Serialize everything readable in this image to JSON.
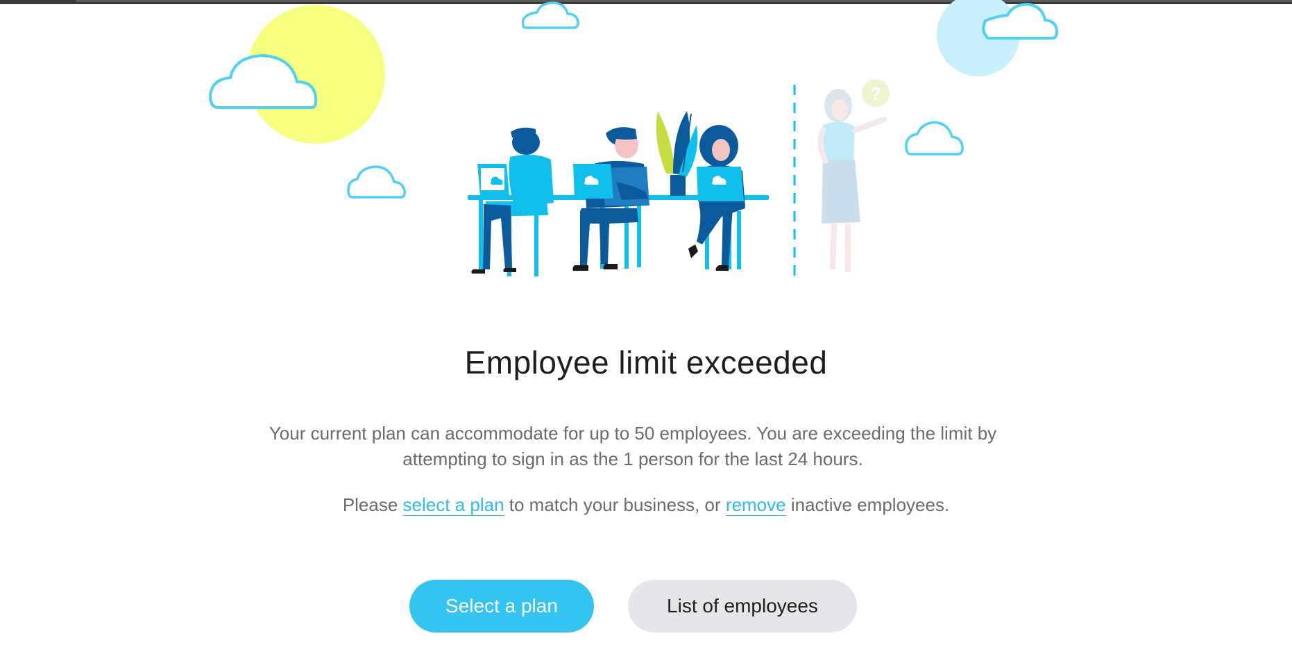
{
  "page": {
    "title": "Employee limit exceeded",
    "description": "Your current plan can accommodate for up to 50 employees. You are exceeding the limit by attempting to sign in as the 1 person for the last 24 hours.",
    "please_prefix": "Please ",
    "select_plan_link": "select a plan",
    "middle_text": " to match your business, or ",
    "remove_link": "remove",
    "suffix_text": " inactive employees."
  },
  "buttons": {
    "select_plan": "Select a plan",
    "list_employees": "List of employees"
  },
  "illustration": {
    "question_mark": "?"
  },
  "colors": {
    "accent": "#33c4f2",
    "link": "#2ebcee",
    "sun": "#f7ff7f",
    "sky_circle": "#c9f0fd",
    "cloud_stroke": "#4fd0f5",
    "figure_dark": "#0a5a9c",
    "figure_light": "#10bfeb",
    "secondary_button": "#e6e6ea"
  }
}
